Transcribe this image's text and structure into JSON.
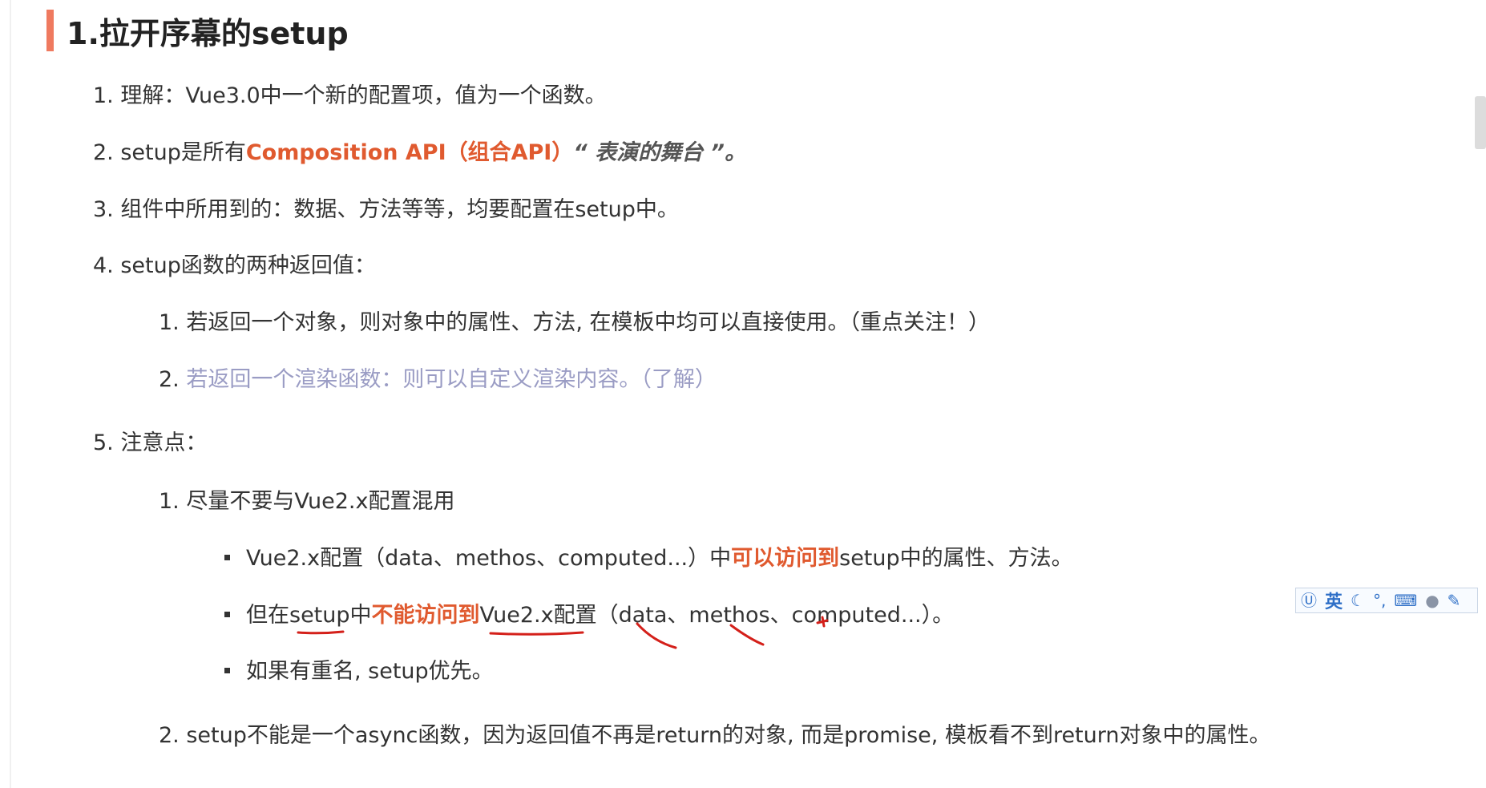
{
  "heading": "1.拉开序幕的setup",
  "items": {
    "i1": {
      "num": "1. ",
      "text": "理解：Vue3.0中一个新的配置项，值为一个函数。"
    },
    "i2": {
      "num": "2. ",
      "pre": "setup是所有",
      "red": "Composition API（组合API）",
      "quote_open": "“ ",
      "italic": "表演的舞台",
      "quote_close": " ”。"
    },
    "i3": {
      "num": "3. ",
      "text": "组件中所用到的：数据、方法等等，均要配置在setup中。"
    },
    "i4": {
      "num": "4. ",
      "text": "setup函数的两种返回值："
    },
    "i4_1": {
      "num": "1. ",
      "text": "若返回一个对象，则对象中的属性、方法, 在模板中均可以直接使用。（重点关注！）"
    },
    "i4_2": {
      "num": "2. ",
      "text": "若返回一个渲染函数：则可以自定义渲染内容。（了解）"
    },
    "i5": {
      "num": "5. ",
      "text": "注意点："
    },
    "i5_1": {
      "num": "1. ",
      "text": "尽量不要与Vue2.x配置混用"
    },
    "b1": {
      "pre": "Vue2.x配置（data、methos、computed...）中",
      "red": "可以访问到",
      "post": "setup中的属性、方法。"
    },
    "b2": {
      "pre": "但在setup中",
      "red": "不能访问到",
      "post": "Vue2.x配置（data、methos、computed...）。"
    },
    "b3": {
      "text": "如果有重名, setup优先。"
    },
    "i5_2": {
      "num": "2. ",
      "text": "setup不能是一个async函数，因为返回值不再是return的对象, 而是promise, 模板看不到return对象中的属性。"
    }
  },
  "ime_toolbar": {
    "lang": "英",
    "icons": [
      "ime-logo-icon",
      "moon-icon",
      "punctuation-icon",
      "keyboard-icon",
      "user-icon",
      "wrench-icon"
    ]
  },
  "colors": {
    "accent_bar": "#ef7a5f",
    "highlight_red": "#e05a2f",
    "muted_purple": "#9a9cc4",
    "annotation_red": "#d4201a"
  }
}
